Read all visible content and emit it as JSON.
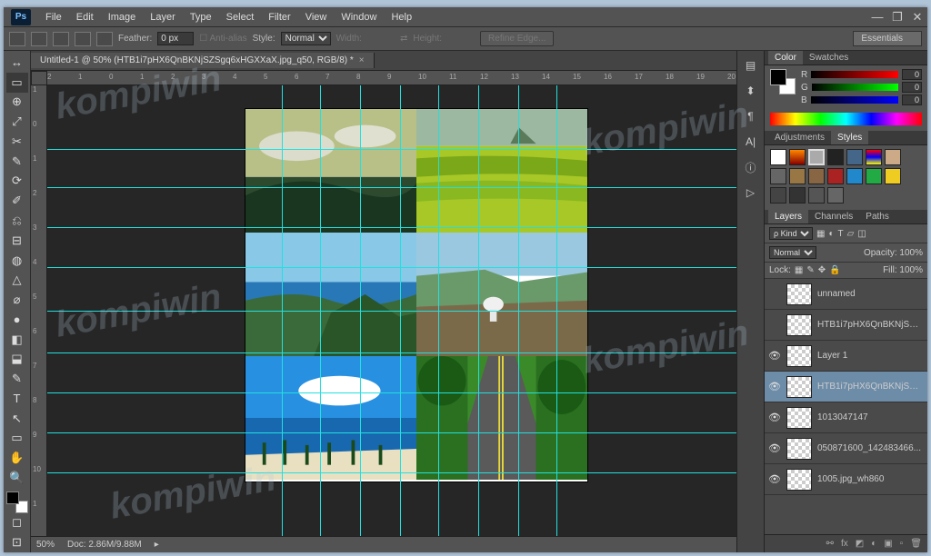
{
  "app": {
    "logo": "Ps"
  },
  "menu": [
    "File",
    "Edit",
    "Image",
    "Layer",
    "Type",
    "Select",
    "Filter",
    "View",
    "Window",
    "Help"
  ],
  "window_buttons": {
    "min": "—",
    "max": "❐",
    "close": "✕"
  },
  "options": {
    "feather_label": "Feather:",
    "feather_value": "0 px",
    "antialias_label": "Anti-alias",
    "style_label": "Style:",
    "style_value": "Normal",
    "width_label": "Width:",
    "height_label": "Height:",
    "refine_button": "Refine Edge...",
    "workspace": "Essentials"
  },
  "document": {
    "tab_title": "Untitled-1 @ 50% (HTB1i7pHX6QnBKNjSZSgq6xHGXXaX.jpg_q50, RGB/8) *",
    "zoom": "50%",
    "doc_label": "Doc: 2.86M/9.88M"
  },
  "ruler_h": [
    "2",
    "1",
    "0",
    "1",
    "2",
    "3",
    "4",
    "5",
    "6",
    "7",
    "8",
    "9",
    "10",
    "11",
    "12",
    "13",
    "14",
    "15",
    "16",
    "17",
    "18",
    "19",
    "20",
    "2"
  ],
  "ruler_v": [
    "1",
    "0",
    "1",
    "2",
    "3",
    "4",
    "5",
    "6",
    "7",
    "8",
    "9",
    "10",
    "1"
  ],
  "tools": [
    "↔",
    "▭",
    "⊕",
    "⤢",
    "✂",
    "✎",
    "⟳",
    "✐",
    "⎌",
    "⊟",
    "◍",
    "△",
    "⌀",
    "●",
    "◧",
    "⬓",
    "✎",
    "T",
    "↖",
    "▭",
    "✋",
    "🔍"
  ],
  "color_panel": {
    "tab_color": "Color",
    "tab_swatches": "Swatches",
    "r_label": "R",
    "r_value": "0",
    "g_label": "G",
    "g_value": "0",
    "b_label": "B",
    "b_value": "0"
  },
  "adjust_panel": {
    "tab_adjust": "Adjustments",
    "tab_styles": "Styles"
  },
  "layers_panel": {
    "tab_layers": "Layers",
    "tab_channels": "Channels",
    "tab_paths": "Paths",
    "kind_label": "ρ Kind",
    "blend_mode": "Normal",
    "opacity_label": "Opacity:",
    "opacity_value": "100%",
    "lock_label": "Lock:",
    "fill_label": "Fill:",
    "fill_value": "100%",
    "layers": [
      {
        "name": "unnamed",
        "visible": false,
        "selected": false
      },
      {
        "name": "HTB1i7pHX6QnBKNjSZS...",
        "visible": false,
        "selected": false
      },
      {
        "name": "Layer 1",
        "visible": true,
        "selected": false
      },
      {
        "name": "HTB1i7pHX6QnBKNjSZS...",
        "visible": true,
        "selected": true
      },
      {
        "name": "1013047147",
        "visible": true,
        "selected": false
      },
      {
        "name": "050871600_142483466...",
        "visible": true,
        "selected": false
      },
      {
        "name": "1005.jpg_wh860",
        "visible": true,
        "selected": false
      }
    ]
  },
  "bottom_icons": [
    "⊡",
    "⊞"
  ],
  "watermark_text": "kompiwin"
}
